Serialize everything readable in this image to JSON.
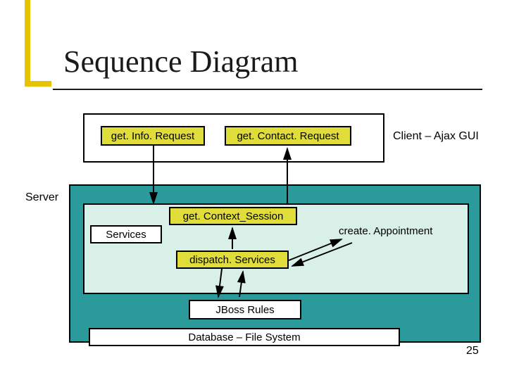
{
  "title": "Sequence Diagram",
  "client": {
    "label": "Client – Ajax GUI",
    "info_request": "get. Info. Request",
    "contact_request": "get. Contact. Request"
  },
  "server": {
    "label": "Server",
    "context_session": "get. Context_Session",
    "services": "Services",
    "create_appointment": "create. Appointment",
    "dispatch": "dispatch. Services",
    "jboss": "JBoss Rules",
    "database": "Database – File System"
  },
  "page_number": "25"
}
